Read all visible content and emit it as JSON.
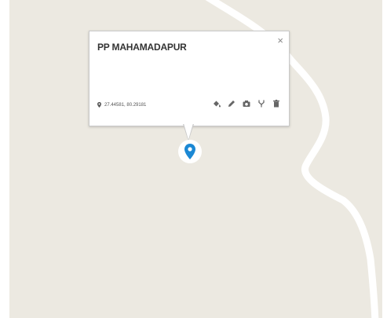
{
  "popup": {
    "title": "PP MAHAMADAPUR",
    "close_label": "×",
    "coordinates": "27.44581, 80.29181",
    "actions": [
      "paint-bucket-icon",
      "pencil-icon",
      "camera-icon",
      "fork-icon",
      "trash-icon"
    ]
  },
  "marker": {
    "icon": "map-pin-icon",
    "color": "#1b88d4"
  },
  "colors": {
    "map_background": "#ece9e1",
    "road": "#ffffff",
    "icon_gray": "#666666"
  }
}
